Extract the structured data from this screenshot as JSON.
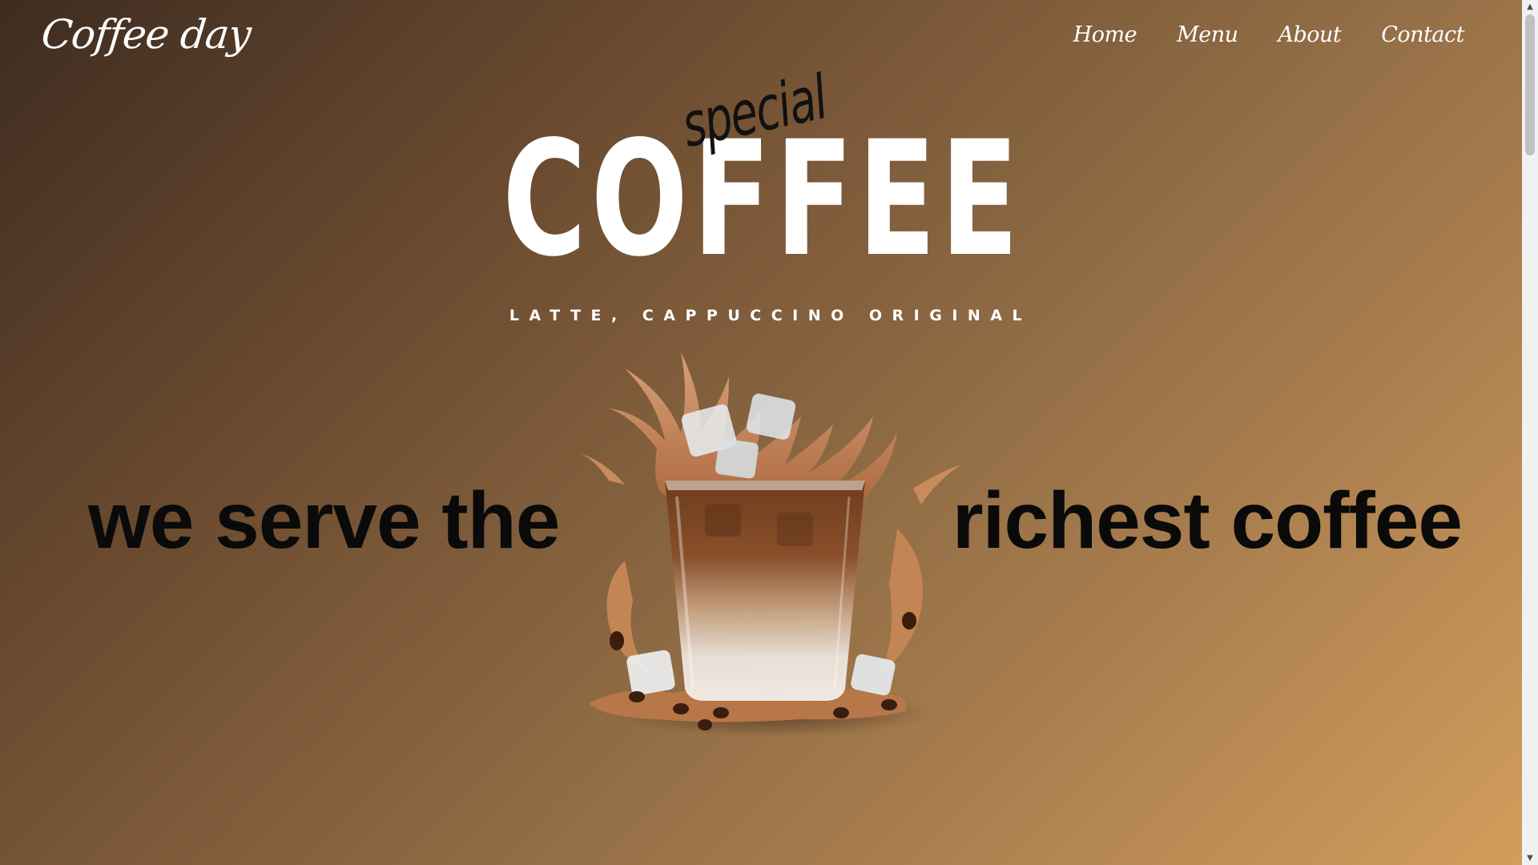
{
  "header": {
    "logo": "Coffee day",
    "nav": [
      {
        "label": "Home"
      },
      {
        "label": "Menu"
      },
      {
        "label": "About"
      },
      {
        "label": "Contact"
      }
    ]
  },
  "hero": {
    "accent_word": "special",
    "title": "COFFEE",
    "subtitle": "LATTE, CAPPUCCINO ORIGINAL",
    "left_text": "we serve the",
    "right_text": "richest coffee",
    "image_icon": "iced-coffee-splash-icon"
  },
  "colors": {
    "gradient_start": "#3e2c20",
    "gradient_end": "#d29e5c",
    "title_text": "#ffffff",
    "dark_text": "#0a0a0a"
  },
  "scroll_position": 0
}
